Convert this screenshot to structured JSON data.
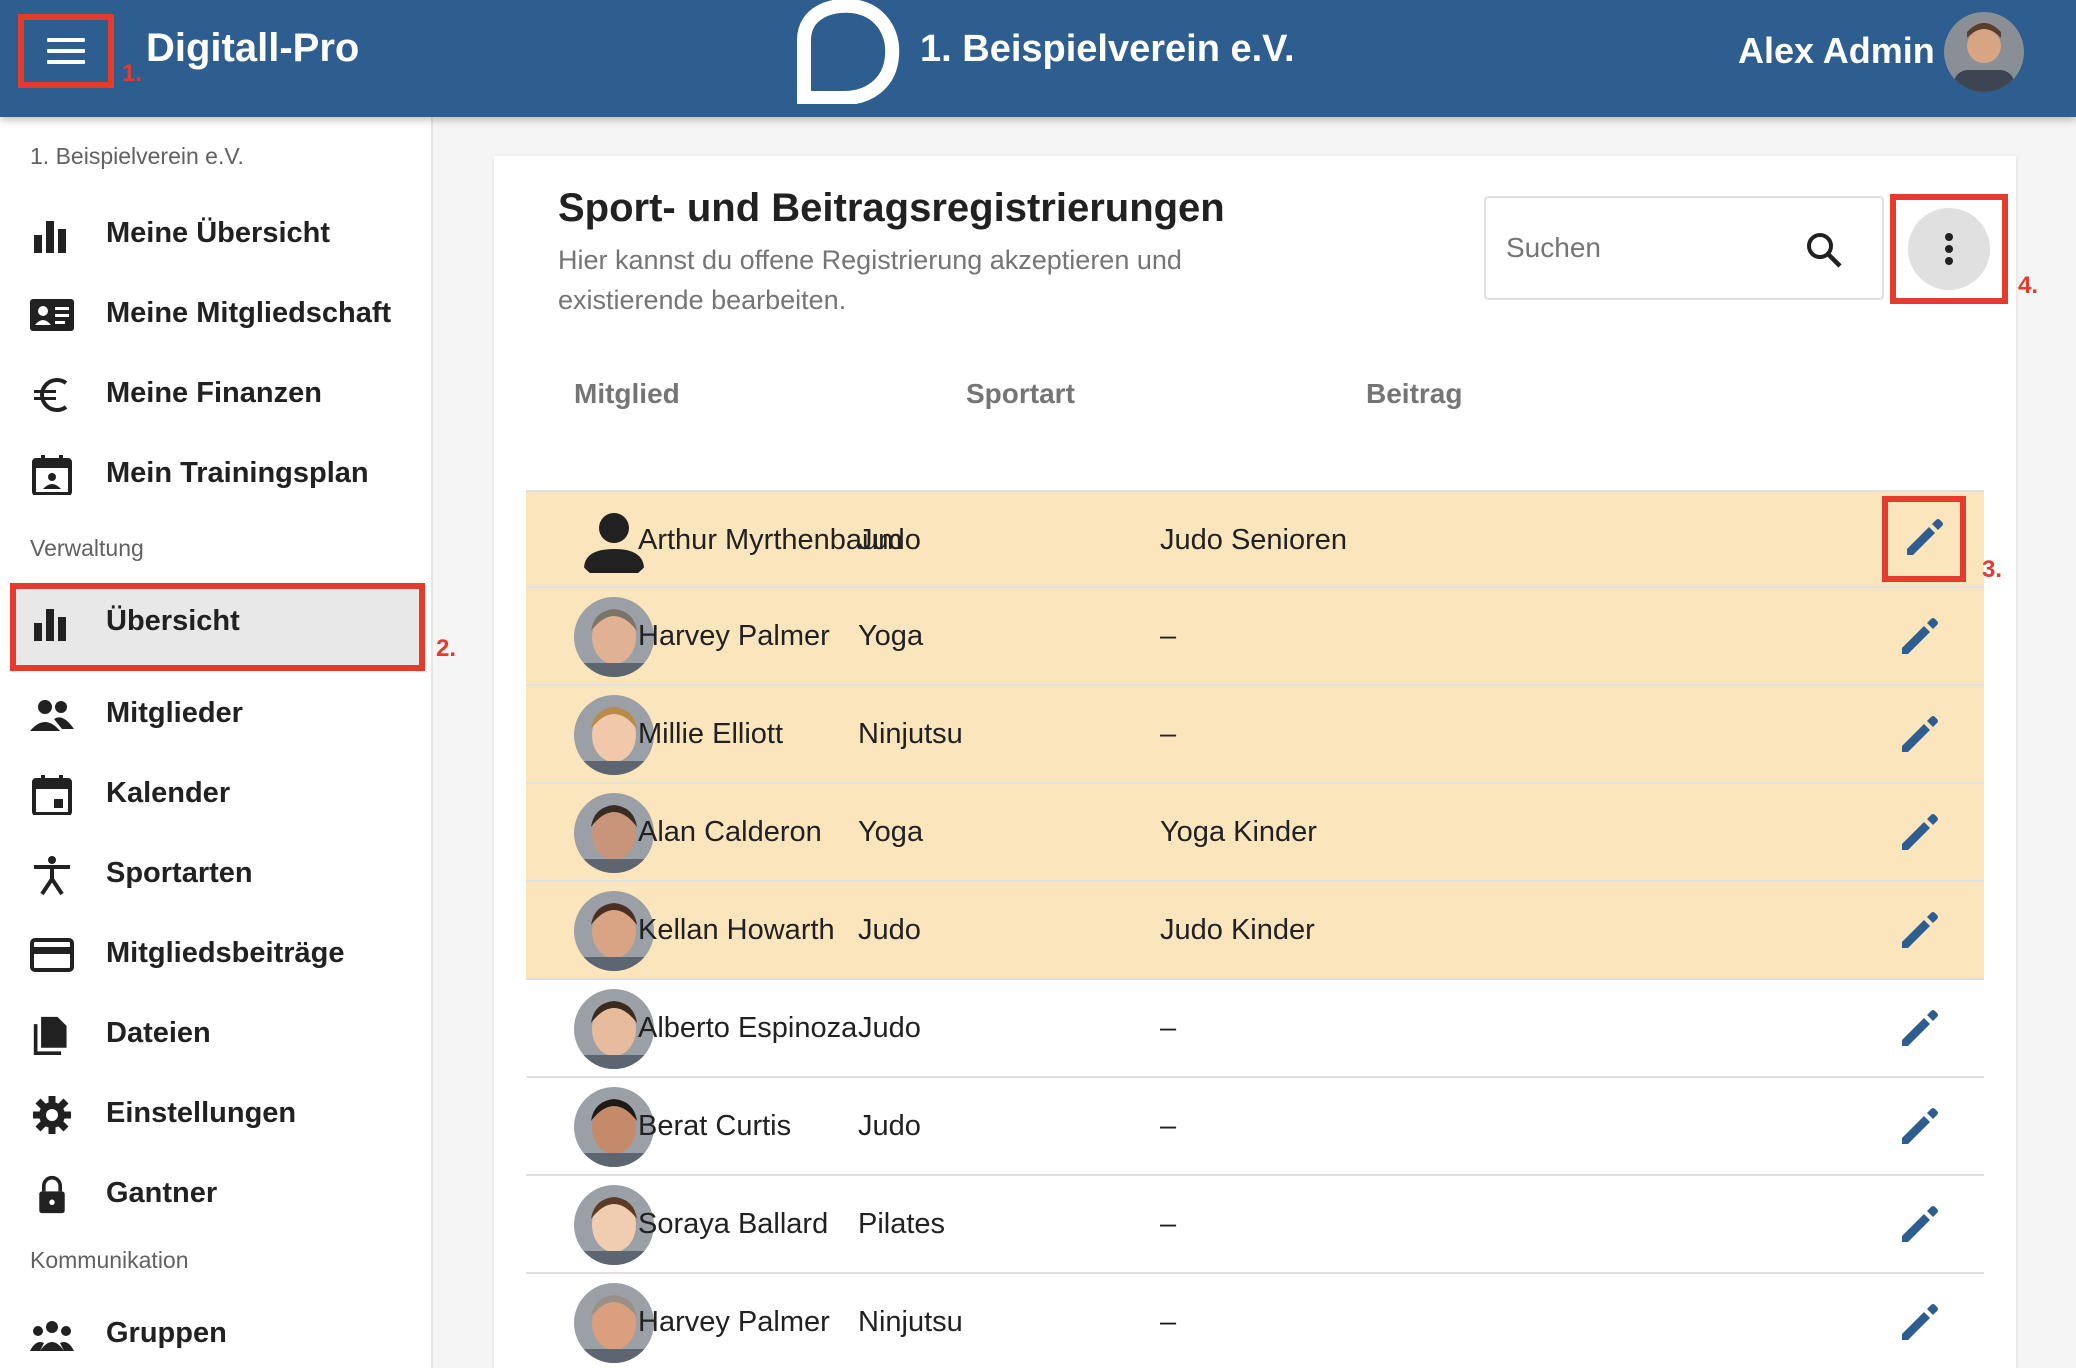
{
  "header": {
    "app_title": "Digitall-Pro",
    "club_title": "1. Beispielverein e.V.",
    "user_name": "Alex Admin",
    "annotation_1": "1."
  },
  "sidebar": {
    "club_label": "1. Beispielverein e.V.",
    "personal_items": [
      {
        "label": "Meine Übersicht",
        "icon": "bar-chart-icon"
      },
      {
        "label": "Meine Mitgliedschaft",
        "icon": "id-card-icon"
      },
      {
        "label": "Meine Finanzen",
        "icon": "euro-icon"
      },
      {
        "label": "Mein Trainingsplan",
        "icon": "calendar-person-icon"
      }
    ],
    "section_admin": "Verwaltung",
    "admin_items": [
      {
        "label": "Übersicht",
        "icon": "bar-chart-icon",
        "active": true
      },
      {
        "label": "Mitglieder",
        "icon": "people-icon"
      },
      {
        "label": "Kalender",
        "icon": "calendar-icon"
      },
      {
        "label": "Sportarten",
        "icon": "sport-figure-icon"
      },
      {
        "label": "Mitgliedsbeiträge",
        "icon": "credit-card-icon"
      },
      {
        "label": "Dateien",
        "icon": "files-icon"
      },
      {
        "label": "Einstellungen",
        "icon": "gear-icon"
      },
      {
        "label": "Gantner",
        "icon": "lock-icon"
      }
    ],
    "section_comm": "Kommunikation",
    "comm_items": [
      {
        "label": "Gruppen",
        "icon": "groups-icon"
      }
    ],
    "annotation_2": "2."
  },
  "main": {
    "title": "Sport- und Beitragsregistrierungen",
    "subtitle": "Hier kannst du offene Registrierung akzeptieren und existierende bearbeiten.",
    "search_placeholder": "Suchen",
    "annotation_3": "3.",
    "annotation_4": "4.",
    "columns": [
      "Mitglied",
      "Sportart",
      "Beitrag"
    ],
    "rows": [
      {
        "name": "Arthur Myrthenbaum",
        "sport": "Judo",
        "fee": "Judo Senioren",
        "pending": true,
        "avatar": "placeholder"
      },
      {
        "name": "Harvey Palmer",
        "sport": "Yoga",
        "fee": "–",
        "pending": true,
        "avatar": "photo"
      },
      {
        "name": "Millie Elliott",
        "sport": "Ninjutsu",
        "fee": "–",
        "pending": true,
        "avatar": "photo"
      },
      {
        "name": "Alan Calderon",
        "sport": "Yoga",
        "fee": "Yoga Kinder",
        "pending": true,
        "avatar": "photo"
      },
      {
        "name": "Kellan Howarth",
        "sport": "Judo",
        "fee": "Judo Kinder",
        "pending": true,
        "avatar": "photo"
      },
      {
        "name": "Alberto Espinoza",
        "sport": "Judo",
        "fee": "–",
        "pending": false,
        "avatar": "photo"
      },
      {
        "name": "Berat Curtis",
        "sport": "Judo",
        "fee": "–",
        "pending": false,
        "avatar": "photo"
      },
      {
        "name": "Soraya Ballard",
        "sport": "Pilates",
        "fee": "–",
        "pending": false,
        "avatar": "photo"
      },
      {
        "name": "Harvey Palmer",
        "sport": "Ninjutsu",
        "fee": "–",
        "pending": false,
        "avatar": "photo"
      }
    ]
  },
  "colors": {
    "header_bg": "#2e5d90",
    "pending_row_bg": "#fbe5bd",
    "edit_icon": "#2e5d90",
    "annotation": "#e53b2c"
  }
}
